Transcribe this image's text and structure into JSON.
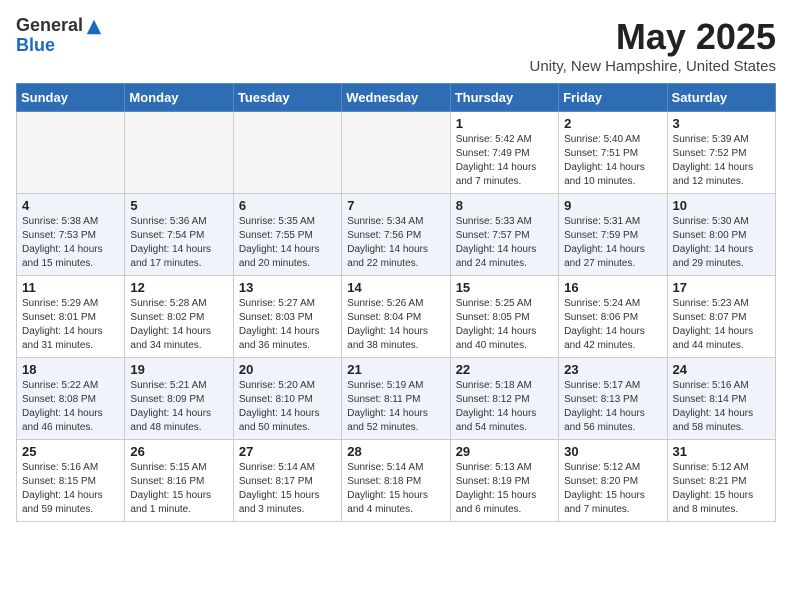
{
  "header": {
    "logo_general": "General",
    "logo_blue": "Blue",
    "month_title": "May 2025",
    "subtitle": "Unity, New Hampshire, United States"
  },
  "weekdays": [
    "Sunday",
    "Monday",
    "Tuesday",
    "Wednesday",
    "Thursday",
    "Friday",
    "Saturday"
  ],
  "weeks": [
    [
      {
        "day": "",
        "info": ""
      },
      {
        "day": "",
        "info": ""
      },
      {
        "day": "",
        "info": ""
      },
      {
        "day": "",
        "info": ""
      },
      {
        "day": "1",
        "info": "Sunrise: 5:42 AM\nSunset: 7:49 PM\nDaylight: 14 hours\nand 7 minutes."
      },
      {
        "day": "2",
        "info": "Sunrise: 5:40 AM\nSunset: 7:51 PM\nDaylight: 14 hours\nand 10 minutes."
      },
      {
        "day": "3",
        "info": "Sunrise: 5:39 AM\nSunset: 7:52 PM\nDaylight: 14 hours\nand 12 minutes."
      }
    ],
    [
      {
        "day": "4",
        "info": "Sunrise: 5:38 AM\nSunset: 7:53 PM\nDaylight: 14 hours\nand 15 minutes."
      },
      {
        "day": "5",
        "info": "Sunrise: 5:36 AM\nSunset: 7:54 PM\nDaylight: 14 hours\nand 17 minutes."
      },
      {
        "day": "6",
        "info": "Sunrise: 5:35 AM\nSunset: 7:55 PM\nDaylight: 14 hours\nand 20 minutes."
      },
      {
        "day": "7",
        "info": "Sunrise: 5:34 AM\nSunset: 7:56 PM\nDaylight: 14 hours\nand 22 minutes."
      },
      {
        "day": "8",
        "info": "Sunrise: 5:33 AM\nSunset: 7:57 PM\nDaylight: 14 hours\nand 24 minutes."
      },
      {
        "day": "9",
        "info": "Sunrise: 5:31 AM\nSunset: 7:59 PM\nDaylight: 14 hours\nand 27 minutes."
      },
      {
        "day": "10",
        "info": "Sunrise: 5:30 AM\nSunset: 8:00 PM\nDaylight: 14 hours\nand 29 minutes."
      }
    ],
    [
      {
        "day": "11",
        "info": "Sunrise: 5:29 AM\nSunset: 8:01 PM\nDaylight: 14 hours\nand 31 minutes."
      },
      {
        "day": "12",
        "info": "Sunrise: 5:28 AM\nSunset: 8:02 PM\nDaylight: 14 hours\nand 34 minutes."
      },
      {
        "day": "13",
        "info": "Sunrise: 5:27 AM\nSunset: 8:03 PM\nDaylight: 14 hours\nand 36 minutes."
      },
      {
        "day": "14",
        "info": "Sunrise: 5:26 AM\nSunset: 8:04 PM\nDaylight: 14 hours\nand 38 minutes."
      },
      {
        "day": "15",
        "info": "Sunrise: 5:25 AM\nSunset: 8:05 PM\nDaylight: 14 hours\nand 40 minutes."
      },
      {
        "day": "16",
        "info": "Sunrise: 5:24 AM\nSunset: 8:06 PM\nDaylight: 14 hours\nand 42 minutes."
      },
      {
        "day": "17",
        "info": "Sunrise: 5:23 AM\nSunset: 8:07 PM\nDaylight: 14 hours\nand 44 minutes."
      }
    ],
    [
      {
        "day": "18",
        "info": "Sunrise: 5:22 AM\nSunset: 8:08 PM\nDaylight: 14 hours\nand 46 minutes."
      },
      {
        "day": "19",
        "info": "Sunrise: 5:21 AM\nSunset: 8:09 PM\nDaylight: 14 hours\nand 48 minutes."
      },
      {
        "day": "20",
        "info": "Sunrise: 5:20 AM\nSunset: 8:10 PM\nDaylight: 14 hours\nand 50 minutes."
      },
      {
        "day": "21",
        "info": "Sunrise: 5:19 AM\nSunset: 8:11 PM\nDaylight: 14 hours\nand 52 minutes."
      },
      {
        "day": "22",
        "info": "Sunrise: 5:18 AM\nSunset: 8:12 PM\nDaylight: 14 hours\nand 54 minutes."
      },
      {
        "day": "23",
        "info": "Sunrise: 5:17 AM\nSunset: 8:13 PM\nDaylight: 14 hours\nand 56 minutes."
      },
      {
        "day": "24",
        "info": "Sunrise: 5:16 AM\nSunset: 8:14 PM\nDaylight: 14 hours\nand 58 minutes."
      }
    ],
    [
      {
        "day": "25",
        "info": "Sunrise: 5:16 AM\nSunset: 8:15 PM\nDaylight: 14 hours\nand 59 minutes."
      },
      {
        "day": "26",
        "info": "Sunrise: 5:15 AM\nSunset: 8:16 PM\nDaylight: 15 hours\nand 1 minute."
      },
      {
        "day": "27",
        "info": "Sunrise: 5:14 AM\nSunset: 8:17 PM\nDaylight: 15 hours\nand 3 minutes."
      },
      {
        "day": "28",
        "info": "Sunrise: 5:14 AM\nSunset: 8:18 PM\nDaylight: 15 hours\nand 4 minutes."
      },
      {
        "day": "29",
        "info": "Sunrise: 5:13 AM\nSunset: 8:19 PM\nDaylight: 15 hours\nand 6 minutes."
      },
      {
        "day": "30",
        "info": "Sunrise: 5:12 AM\nSunset: 8:20 PM\nDaylight: 15 hours\nand 7 minutes."
      },
      {
        "day": "31",
        "info": "Sunrise: 5:12 AM\nSunset: 8:21 PM\nDaylight: 15 hours\nand 8 minutes."
      }
    ]
  ]
}
